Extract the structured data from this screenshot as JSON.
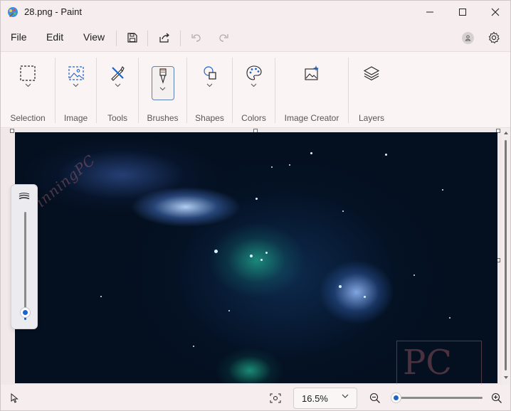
{
  "window": {
    "title": "28.png - Paint"
  },
  "menu": {
    "file": "File",
    "edit": "Edit",
    "view": "View"
  },
  "ribbon": {
    "groups": [
      {
        "label": "Selection",
        "icon": "selection-icon"
      },
      {
        "label": "Image",
        "icon": "image-icon"
      },
      {
        "label": "Tools",
        "icon": "tools-icon"
      },
      {
        "label": "Brushes",
        "icon": "brush-icon"
      },
      {
        "label": "Shapes",
        "icon": "shapes-icon"
      },
      {
        "label": "Colors",
        "icon": "palette-icon"
      },
      {
        "label": "Image Creator",
        "icon": "image-creator-icon"
      },
      {
        "label": "Layers",
        "icon": "layers-icon"
      }
    ]
  },
  "watermark": {
    "text": "WinningPC",
    "logo": "PC"
  },
  "status": {
    "zoom_value": "16.5%",
    "zoom_slider_level": 0.05,
    "brush_size_level": 0.05
  },
  "colors": {
    "accent": "#1f63c6",
    "canvas_bg": "#04101f",
    "window_bg": "#f6eeee"
  }
}
